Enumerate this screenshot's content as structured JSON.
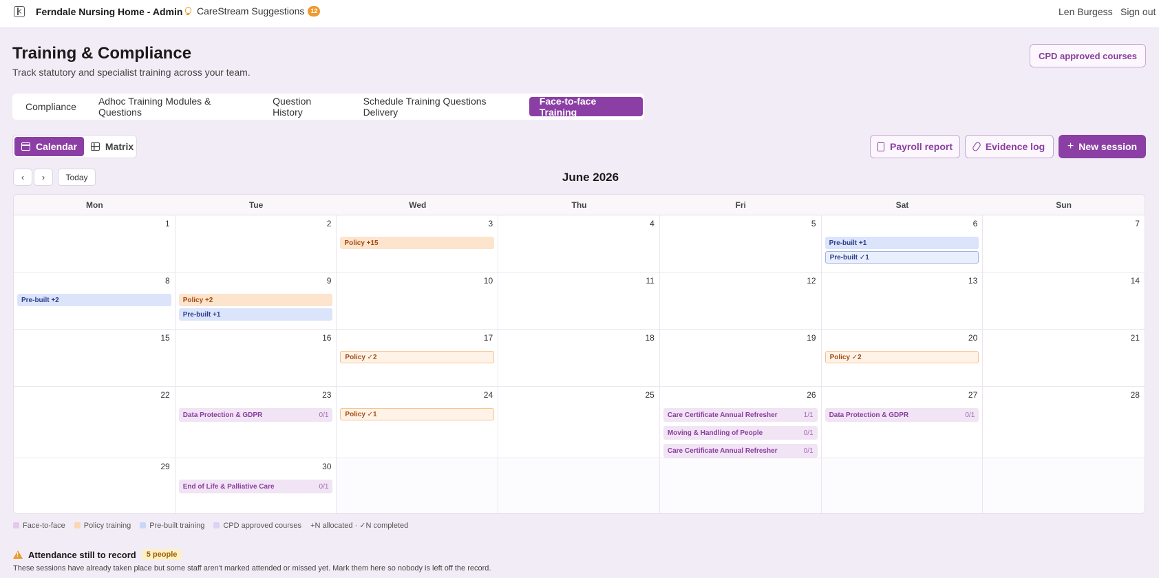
{
  "topbar": {
    "app_title": "Ferndale Nursing Home - Admin",
    "suggestions_label": "CareStream Suggestions",
    "suggestions_count": "12",
    "user_name": "Len Burgess",
    "signout_label": "Sign out"
  },
  "header": {
    "title": "Training & Compliance",
    "subtitle": "Track statutory and specialist training across your team.",
    "cpd_button": "CPD approved courses"
  },
  "tabs": [
    {
      "label": "Compliance",
      "active": false
    },
    {
      "label": "Adhoc Training Modules & Questions",
      "active": false
    },
    {
      "label": "Question History",
      "active": false
    },
    {
      "label": "Schedule Training Questions Delivery",
      "active": false
    },
    {
      "label": "Face-to-face Training",
      "active": true
    }
  ],
  "view_toggle": {
    "calendar": "Calendar",
    "matrix": "Matrix",
    "active": "calendar"
  },
  "actions": {
    "payroll": "Payroll report",
    "evidence": "Evidence log",
    "new_session": "New session"
  },
  "nav": {
    "prev": "‹",
    "next": "›",
    "today": "Today",
    "month": "June 2026"
  },
  "calendar": {
    "weekdays": [
      "Mon",
      "Tue",
      "Wed",
      "Thu",
      "Fri",
      "Sat",
      "Sun"
    ],
    "weeks": [
      [
        {
          "day": "1",
          "events": []
        },
        {
          "day": "2",
          "events": []
        },
        {
          "day": "3",
          "events": [
            {
              "label": "Policy +15",
              "kind": "policy"
            }
          ]
        },
        {
          "day": "4",
          "events": []
        },
        {
          "day": "5",
          "events": []
        },
        {
          "day": "6",
          "events": [
            {
              "label": "Pre-built +1",
              "kind": "prebuilt"
            },
            {
              "label": "Pre-built ✓1",
              "kind": "prebuilt done"
            }
          ]
        },
        {
          "day": "7",
          "events": []
        }
      ],
      [
        {
          "day": "8",
          "events": [
            {
              "label": "Pre-built +2",
              "kind": "prebuilt"
            }
          ]
        },
        {
          "day": "9",
          "events": [
            {
              "label": "Policy +2",
              "kind": "policy"
            },
            {
              "label": "Pre-built +1",
              "kind": "prebuilt"
            }
          ]
        },
        {
          "day": "10",
          "events": []
        },
        {
          "day": "11",
          "events": []
        },
        {
          "day": "12",
          "events": []
        },
        {
          "day": "13",
          "events": []
        },
        {
          "day": "14",
          "events": []
        }
      ],
      [
        {
          "day": "15",
          "events": []
        },
        {
          "day": "16",
          "events": []
        },
        {
          "day": "17",
          "events": [
            {
              "label": "Policy ✓2",
              "kind": "policy done"
            }
          ]
        },
        {
          "day": "18",
          "events": []
        },
        {
          "day": "19",
          "events": []
        },
        {
          "day": "20",
          "events": [
            {
              "label": "Policy ✓2",
              "kind": "policy done"
            }
          ]
        },
        {
          "day": "21",
          "events": []
        }
      ],
      [
        {
          "day": "22",
          "events": []
        },
        {
          "day": "23",
          "events": [
            {
              "label": "Data Protection & GDPR",
              "kind": "f2f",
              "ratio": "0/1"
            }
          ]
        },
        {
          "day": "24",
          "events": [
            {
              "label": "Policy ✓1",
              "kind": "policy done"
            }
          ]
        },
        {
          "day": "25",
          "events": []
        },
        {
          "day": "26",
          "events": [
            {
              "label": "Care Certificate Annual Refresher",
              "kind": "f2f",
              "ratio": "1/1"
            },
            {
              "label": "Moving & Handling of People",
              "kind": "f2f",
              "ratio": "0/1"
            },
            {
              "label": "Care Certificate Annual Refresher",
              "kind": "f2f",
              "ratio": "0/1"
            }
          ]
        },
        {
          "day": "27",
          "events": [
            {
              "label": "Data Protection & GDPR",
              "kind": "f2f",
              "ratio": "0/1"
            }
          ]
        },
        {
          "day": "28",
          "events": []
        }
      ],
      [
        {
          "day": "29",
          "events": []
        },
        {
          "day": "30",
          "events": [
            {
              "label": "End of Life & Palliative Care",
              "kind": "f2f",
              "ratio": "0/1"
            }
          ]
        },
        {
          "day": "",
          "events": []
        },
        {
          "day": "",
          "events": []
        },
        {
          "day": "",
          "events": []
        },
        {
          "day": "",
          "events": []
        },
        {
          "day": "",
          "events": []
        }
      ]
    ]
  },
  "legend": {
    "items": [
      {
        "label": "Face-to-face",
        "color": "#e3c9ea"
      },
      {
        "label": "Policy training",
        "color": "#fcd6b0"
      },
      {
        "label": "Pre-built training",
        "color": "#c9d6f8"
      },
      {
        "label": "CPD approved courses",
        "color": "#ddd2f3"
      }
    ],
    "note": "+N allocated · ✓N completed"
  },
  "attendance": {
    "title": "Attendance still to record",
    "badge": "5 people",
    "description": "These sessions have already taken place but some staff aren't marked attended or missed yet. Mark them here so nobody is left off the record."
  },
  "colors": {
    "accent": "#8b3fa4",
    "background": "#f2ecf6"
  }
}
